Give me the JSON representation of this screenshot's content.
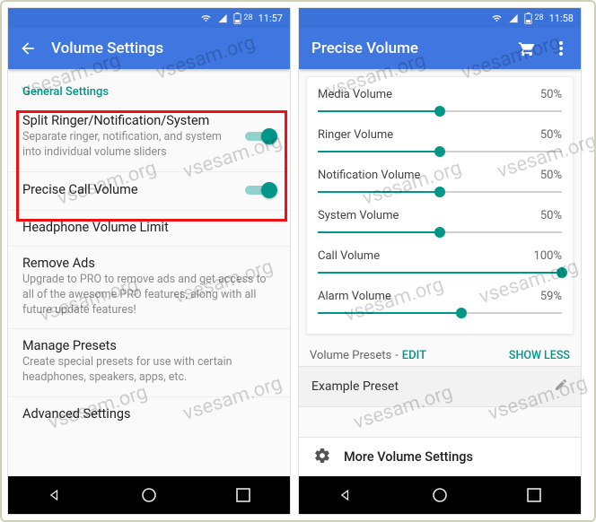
{
  "watermark": "vsesam.org",
  "accent": "#009688",
  "left": {
    "status": {
      "battery": "28",
      "time": "11:57"
    },
    "appbar_title": "Volume Settings",
    "section_header": "General Settings",
    "items": {
      "split": {
        "label": "Split Ringer/Notification/System",
        "sub": "Separate ringer, notification, and system into individual volume sliders",
        "on": true
      },
      "precise_call": {
        "label": "Precise Call Volume",
        "on": true
      },
      "headphone": {
        "label": "Headphone Volume Limit"
      },
      "remove_ads": {
        "label": "Remove Ads",
        "sub": "Upgrade to PRO to remove ads and get access to all of the awesome PRO features, along with all future update features!"
      },
      "manage_presets": {
        "label": "Manage Presets",
        "sub": "Create special presets for use with certain headphones, speakers, apps, etc."
      },
      "advanced": {
        "label": "Advanced Settings"
      }
    }
  },
  "right": {
    "status": {
      "battery": "28",
      "time": "11:58"
    },
    "appbar_title": "Precise Volume",
    "sliders": [
      {
        "label": "Media Volume",
        "value_text": "50%",
        "pct": 50
      },
      {
        "label": "Ringer Volume",
        "value_text": "50%",
        "pct": 50
      },
      {
        "label": "Notification Volume",
        "value_text": "50%",
        "pct": 50
      },
      {
        "label": "System Volume",
        "value_text": "50%",
        "pct": 50
      },
      {
        "label": "Call Volume",
        "value_text": "100%",
        "pct": 100
      },
      {
        "label": "Alarm Volume",
        "value_text": "59%",
        "pct": 59
      }
    ],
    "presets_label": "Volume Presets",
    "edit_label": "EDIT",
    "show_less": "SHOW LESS",
    "preset_item": "Example Preset",
    "more_settings": "More Volume Settings"
  }
}
